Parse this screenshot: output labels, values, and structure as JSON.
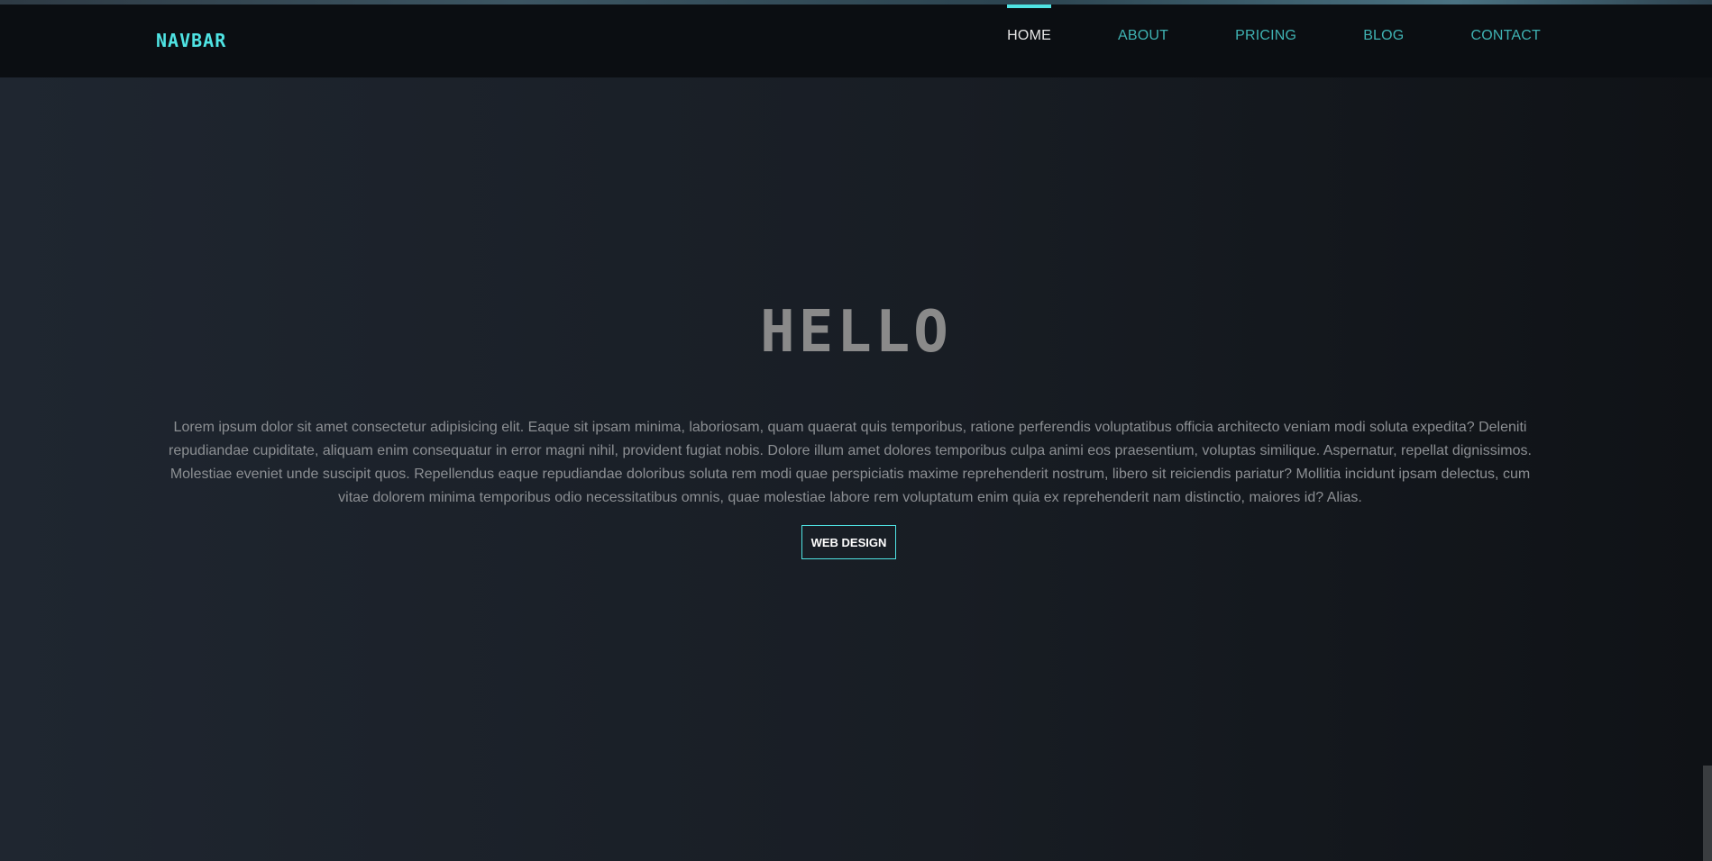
{
  "navbar": {
    "brand": "NAVBAR",
    "links": [
      {
        "label": "HOME",
        "active": true
      },
      {
        "label": "ABOUT",
        "active": false
      },
      {
        "label": "PRICING",
        "active": false
      },
      {
        "label": "BLOG",
        "active": false
      },
      {
        "label": "CONTACT",
        "active": false
      }
    ]
  },
  "hero": {
    "title": "HELLO",
    "text": "Lorem ipsum dolor sit amet consectetur adipisicing elit. Eaque sit ipsam minima, laboriosam, quam quaerat quis temporibus, ratione perferendis voluptatibus officia architecto veniam modi soluta expedita? Deleniti repudiandae cupiditate, aliquam enim consequatur in error magni nihil, provident fugiat nobis. Dolore illum amet dolores temporibus culpa animi eos praesentium, voluptas similique. Aspernatur, repellat dignissimos. Molestiae eveniet unde suscipit quos. Repellendus eaque repudiandae doloribus soluta rem modi quae perspiciatis maxime reprehenderit nostrum, libero sit reiciendis pariatur? Mollitia incidunt ipsam delectus, cum vitae dolorem minima temporibus odio necessitatibus omnis, quae molestiae labore rem voluptatum enim quia ex reprehenderit nam distinctio, maiores id? Alias.",
    "button_label": "WEB DESIGN"
  },
  "colors": {
    "accent": "#4fe3e3",
    "nav_link": "#3fb3b3",
    "nav_active": "#e6e6e6",
    "navbar_bg": "#0b0e12",
    "title": "#8a8a8a"
  }
}
